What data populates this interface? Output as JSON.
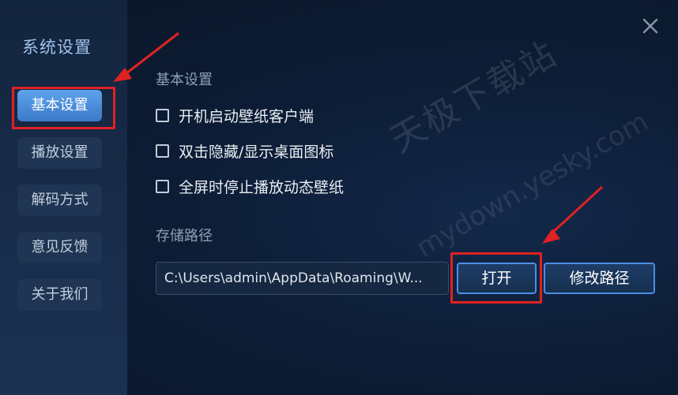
{
  "sidebar": {
    "title": "系统设置",
    "items": [
      {
        "label": "基本设置",
        "active": true
      },
      {
        "label": "播放设置",
        "active": false
      },
      {
        "label": "解码方式",
        "active": false
      },
      {
        "label": "意见反馈",
        "active": false
      },
      {
        "label": "关于我们",
        "active": false
      }
    ]
  },
  "close_icon": "close-icon",
  "basic": {
    "section_title": "基本设置",
    "options": [
      {
        "label": "开机启动壁纸客户端",
        "checked": false
      },
      {
        "label": "双击隐藏/显示桌面图标",
        "checked": false
      },
      {
        "label": "全屏时停止播放动态壁纸",
        "checked": false
      }
    ]
  },
  "storage": {
    "section_title": "存储路径",
    "path_value": "C:\\Users\\admin\\AppData\\Roaming\\W...",
    "open_button": "打开",
    "change_button": "修改路径"
  },
  "watermark": {
    "text": "天极下载站",
    "url": "mydown.yesky.com"
  },
  "colors": {
    "accent": "#4a8fe6",
    "active_item": "#3a79c8",
    "annotation": "#e02222"
  }
}
